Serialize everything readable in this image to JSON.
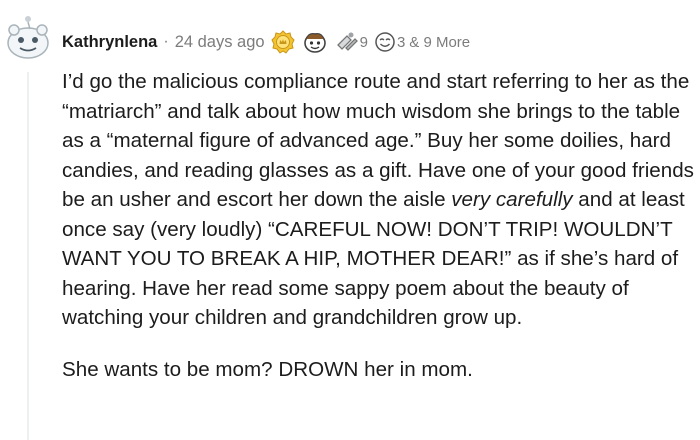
{
  "comment": {
    "author": "Kathrynlena",
    "separator": "·",
    "timestamp": "24 days ago",
    "awards": [
      {
        "icon": "gold-crown-award-icon"
      },
      {
        "icon": "wholesome-award-icon"
      },
      {
        "icon": "silver-award-icon",
        "count": "9"
      },
      {
        "icon": "smile-award-icon",
        "count": "3"
      }
    ],
    "more_awards": "& 9 More",
    "paragraph1": {
      "part1": "I’d go the malicious compliance route and start referring to her as the “matriarch” and talk about how much wisdom she brings to the table as a “maternal figure of advanced age.” Buy her some doilies, hard candies, and reading glasses as a gift. Have one of your good friends be an usher and escort her down the aisle ",
      "emphasis": "very carefully",
      "part2": " and at least once say (very loudly) “CAREFUL NOW! DON’T TRIP! WOULDN’T WANT YOU TO BREAK A HIP, MOTHER DEAR!” as if she’s hard of hearing. Have her read some sappy poem about the beauty of watching your children and grandchildren grow up."
    },
    "paragraph2": "She wants to be mom? DROWN her in mom."
  },
  "colors": {
    "text": "#1c1c1c",
    "meta": "#7c7c7c",
    "thread_line": "#edeff1",
    "gold": "#f4c430"
  }
}
